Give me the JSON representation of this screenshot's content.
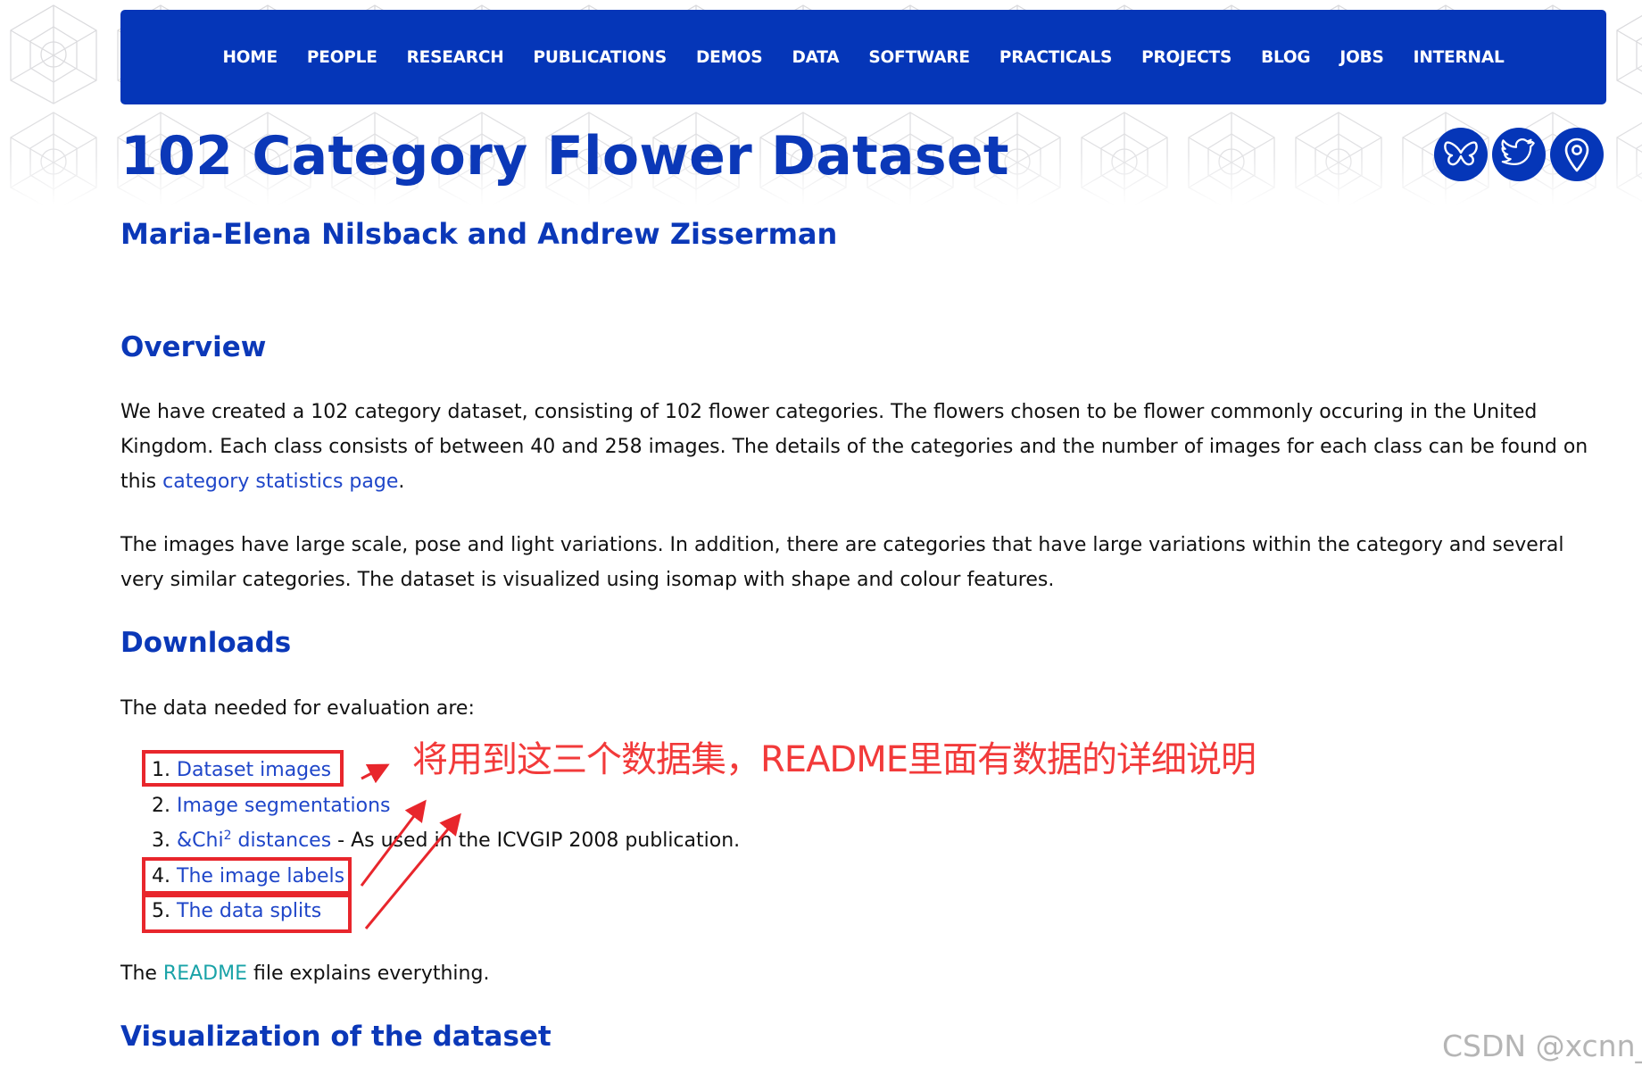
{
  "nav": {
    "items": [
      {
        "label": "HOME"
      },
      {
        "label": "PEOPLE"
      },
      {
        "label": "RESEARCH"
      },
      {
        "label": "PUBLICATIONS"
      },
      {
        "label": "DEMOS"
      },
      {
        "label": "DATA"
      },
      {
        "label": "SOFTWARE"
      },
      {
        "label": "PRACTICALS"
      },
      {
        "label": "PROJECTS"
      },
      {
        "label": "BLOG"
      },
      {
        "label": "JOBS"
      },
      {
        "label": "INTERNAL"
      }
    ]
  },
  "page": {
    "title": "102 Category Flower Dataset",
    "authors": "Maria-Elena Nilsback and Andrew Zisserman"
  },
  "social": {
    "icons": [
      "butterfly-icon",
      "twitter-bird-icon",
      "map-pin-icon"
    ]
  },
  "overview": {
    "heading": "Overview",
    "p1_text": "We have created a 102 category dataset, consisting of 102 flower categories. The flowers chosen to be flower commonly occuring in the United Kingdom. Each class consists of between 40 and 258 images. The details of the categories and the number of images for each class can be found on this ",
    "p1_link": "category statistics page",
    "p1_end": ".",
    "p2_text": "The images have large scale, pose and light variations. In addition, there are categories that have large variations within the category and several very similar categories. The dataset is visualized using isomap with shape and colour features."
  },
  "downloads": {
    "heading": "Downloads",
    "intro": "The data needed for evaluation are:",
    "items": [
      {
        "num": "1.",
        "link": "Dataset images",
        "suffix": ""
      },
      {
        "num": "2.",
        "link": "Image segmentations",
        "suffix": ""
      },
      {
        "num": "3.",
        "link": "&Chi",
        "sup": "2",
        "link_rest": " distances",
        "suffix": " - As used in the ICVGIP 2008 publication."
      },
      {
        "num": "4.",
        "link": "The image labels",
        "suffix": ""
      },
      {
        "num": "5.",
        "link": "The data splits",
        "suffix": ""
      }
    ],
    "readme_pre": "The ",
    "readme_link": "README",
    "readme_post": " file explains everything."
  },
  "visualization": {
    "heading": "Visualization of the dataset"
  },
  "annotation": {
    "text": "将用到这三个数据集，README里面有数据的详细说明",
    "color": "#f23a3a"
  },
  "watermark": "CSDN @xcnn_",
  "colors": {
    "navbar": "#0536b8",
    "heading": "#0b38b8",
    "link": "#1f46c9",
    "readme_link": "#1aa3a8",
    "highlight_box": "#e8262c"
  }
}
